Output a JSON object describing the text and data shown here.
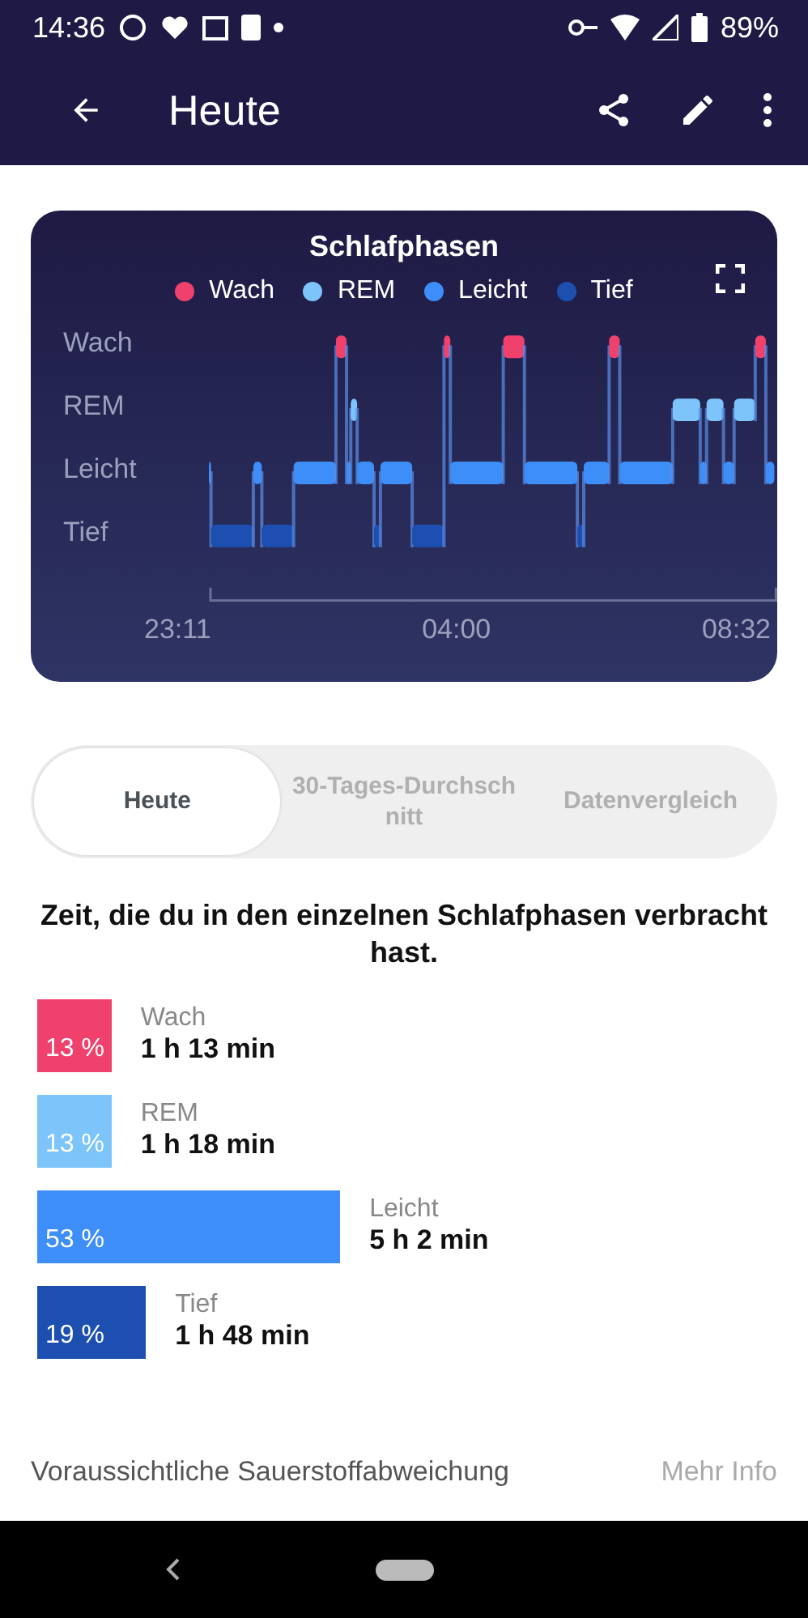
{
  "status_bar": {
    "time": "14:36",
    "battery": "89%"
  },
  "app_bar": {
    "title": "Heute"
  },
  "chart_card": {
    "title": "Schlafphasen",
    "legend": [
      {
        "label": "Wach",
        "color": "#f0416c"
      },
      {
        "label": "REM",
        "color": "#7cc4fa"
      },
      {
        "label": "Leicht",
        "color": "#3d8ef8"
      },
      {
        "label": "Tief",
        "color": "#1c4fb0"
      }
    ],
    "y_labels": [
      "Wach",
      "REM",
      "Leicht",
      "Tief"
    ],
    "x_labels": [
      "23:11",
      "04:00",
      "08:32"
    ]
  },
  "tabs": [
    {
      "label": "Heute",
      "selected": true
    },
    {
      "label": "30-Tages-Durchschnitt",
      "selected": false
    },
    {
      "label": "Datenvergleich",
      "selected": false
    }
  ],
  "heading": "Zeit, die du in den einzelnen Schlafphasen verbracht hast.",
  "stages": [
    {
      "name": "Wach",
      "percent": "13 %",
      "duration": "1 h 13 min",
      "color": "#f0416c"
    },
    {
      "name": "REM",
      "percent": "13 %",
      "duration": "1 h 18 min",
      "color": "#7cc4fa"
    },
    {
      "name": "Leicht",
      "percent": "53 %",
      "duration": "5 h 2 min",
      "color": "#3d8ef8"
    },
    {
      "name": "Tief",
      "percent": "19 %",
      "duration": "1 h 48 min",
      "color": "#1c4fb0"
    }
  ],
  "footer_row": {
    "label": "Voraussichtliche Sauerstoffabweichung",
    "link": "Mehr Info"
  }
}
